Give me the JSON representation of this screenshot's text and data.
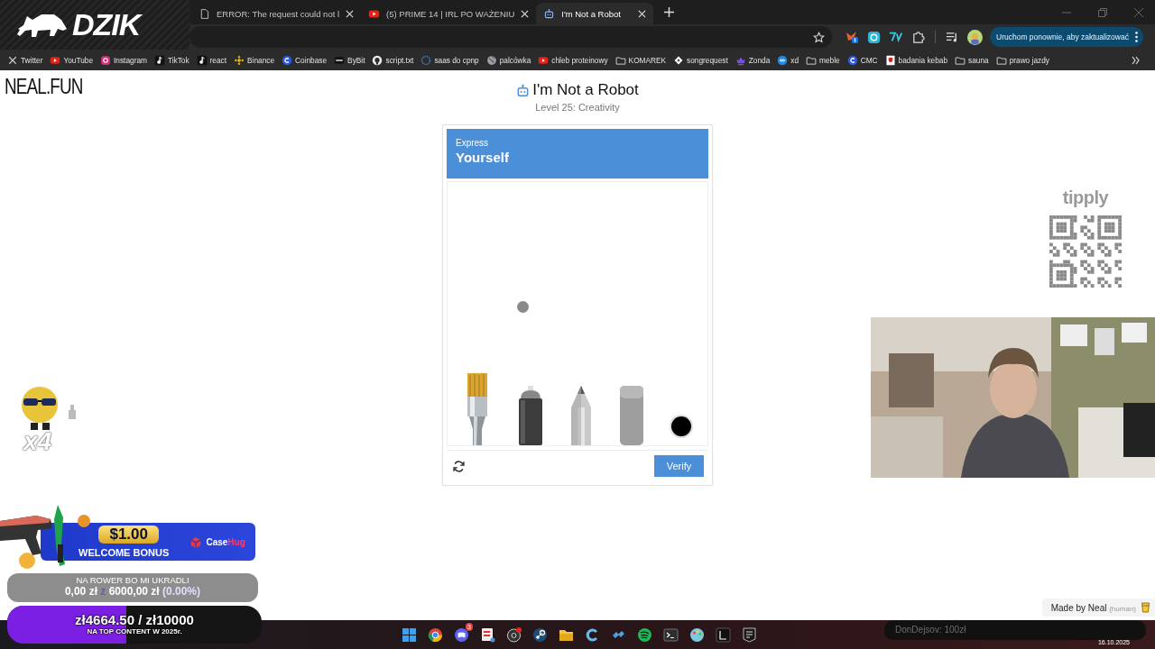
{
  "browser": {
    "tabs": [
      {
        "title": "ERROR: The request could not l",
        "kind": "page",
        "selected": false
      },
      {
        "title": "(5) PRIME 14 | IRL PO WAŻENIU",
        "kind": "video",
        "selected": false
      },
      {
        "title": "I'm Not a Robot",
        "kind": "robot",
        "selected": true
      }
    ],
    "update_button": "Uruchom ponownie, aby zaktualizować",
    "bookmarks": [
      {
        "label": "Twitter",
        "kind": "x"
      },
      {
        "label": "YouTube",
        "kind": "video"
      },
      {
        "label": "Instagram",
        "kind": "camera"
      },
      {
        "label": "TikTok",
        "kind": "note"
      },
      {
        "label": "react",
        "kind": "note"
      },
      {
        "label": "Binance",
        "kind": "diamonds"
      },
      {
        "label": "Coinbase",
        "kind": "coin"
      },
      {
        "label": "ByBit",
        "kind": "tile"
      },
      {
        "label": "script.txt",
        "kind": "octo"
      },
      {
        "label": "saas do cpnp",
        "kind": "ring"
      },
      {
        "label": "palcówka",
        "kind": "globe"
      },
      {
        "label": "chleb proteinowy",
        "kind": "video"
      },
      {
        "label": "KOMAREK",
        "kind": "folder"
      },
      {
        "label": "songrequest",
        "kind": "gem"
      },
      {
        "label": "Zonda",
        "kind": "crown"
      },
      {
        "label": "xd",
        "kind": "link"
      },
      {
        "label": "meble",
        "kind": "folder"
      },
      {
        "label": "CMC",
        "kind": "coin"
      },
      {
        "label": "badania kebab",
        "kind": "flag"
      },
      {
        "label": "sauna",
        "kind": "folder"
      },
      {
        "label": "prawo jazdy",
        "kind": "folder"
      }
    ]
  },
  "page": {
    "site_logo": "NEAL.FUN",
    "title": "I'm Not a Robot",
    "subtitle": "Level 25: Creativity",
    "challenge": {
      "prompt": "Express",
      "headline": "Yourself",
      "tools": [
        {
          "kind": "brush"
        },
        {
          "kind": "spray"
        },
        {
          "kind": "pencil"
        },
        {
          "kind": "eraser"
        },
        {
          "kind": "swatch",
          "color": "#000000"
        }
      ],
      "verify_button": "Verify"
    },
    "credit": "Made by Neal",
    "credit_note": "(human)"
  },
  "overlays": {
    "brand": "DZIK",
    "sticker_count": "x4",
    "tipply_logo": "tipply",
    "promo": {
      "amount": "$1.00",
      "label": "WELCOME BONUS",
      "brand_a": "Case",
      "brand_b": "Hug"
    },
    "goal": {
      "title": "NA ROWER BO MI UKRADLI",
      "raised": "0,00 zł",
      "separator": "z",
      "target": "6000,00 zł",
      "percent": "(0.00%)"
    },
    "top_goal": {
      "amount": "zł4664.50 / zł10000",
      "caption": "NA TOP CONTENT W 2025r.",
      "level": 0.4664
    },
    "alert": "DonDejsov: 100zł"
  },
  "taskbar": {
    "apps": [
      {
        "kind": "start"
      },
      {
        "kind": "browser"
      },
      {
        "kind": "chat",
        "badge": "3"
      },
      {
        "kind": "tool"
      },
      {
        "kind": "recorder"
      },
      {
        "kind": "steam"
      },
      {
        "kind": "folder"
      },
      {
        "kind": "cleaner"
      },
      {
        "kind": "blocks"
      },
      {
        "kind": "music"
      },
      {
        "kind": "terminal"
      },
      {
        "kind": "palette"
      },
      {
        "kind": "square"
      },
      {
        "kind": "store"
      }
    ],
    "date": "16.10.2025"
  }
}
